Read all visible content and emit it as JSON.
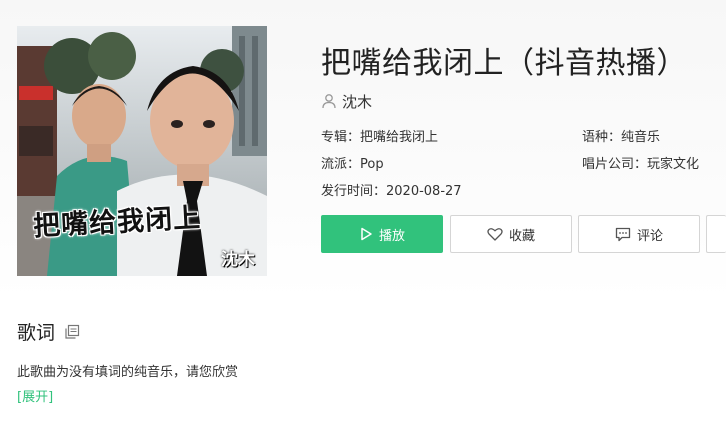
{
  "cover": {
    "title_text": "把嘴给我闭上",
    "artist_text": "沈木"
  },
  "song": {
    "title": "把嘴给我闭上（抖音热播）",
    "artist": "沈木",
    "album_label": "专辑：",
    "album": "把嘴给我闭上",
    "language_label": "语种：",
    "language": "纯音乐",
    "genre_label": "流派：",
    "genre": "Pop",
    "label_label": "唱片公司：",
    "label": "玩家文化",
    "release_label": "发行时间：",
    "release_date": "2020-08-27"
  },
  "actions": {
    "play": "播放",
    "favorite": "收藏",
    "comment": "评论"
  },
  "lyrics": {
    "heading": "歌词",
    "text": "此歌曲为没有填词的纯音乐，请您欣赏",
    "expand": "[展开]"
  },
  "colors": {
    "accent": "#31c27c",
    "title": "#222222",
    "text": "#333333",
    "border": "#d5d5d5"
  },
  "icons": {
    "artist": "person-icon",
    "play": "play-icon",
    "favorite": "heart-icon",
    "comment": "comment-icon",
    "copy": "copy-icon"
  }
}
